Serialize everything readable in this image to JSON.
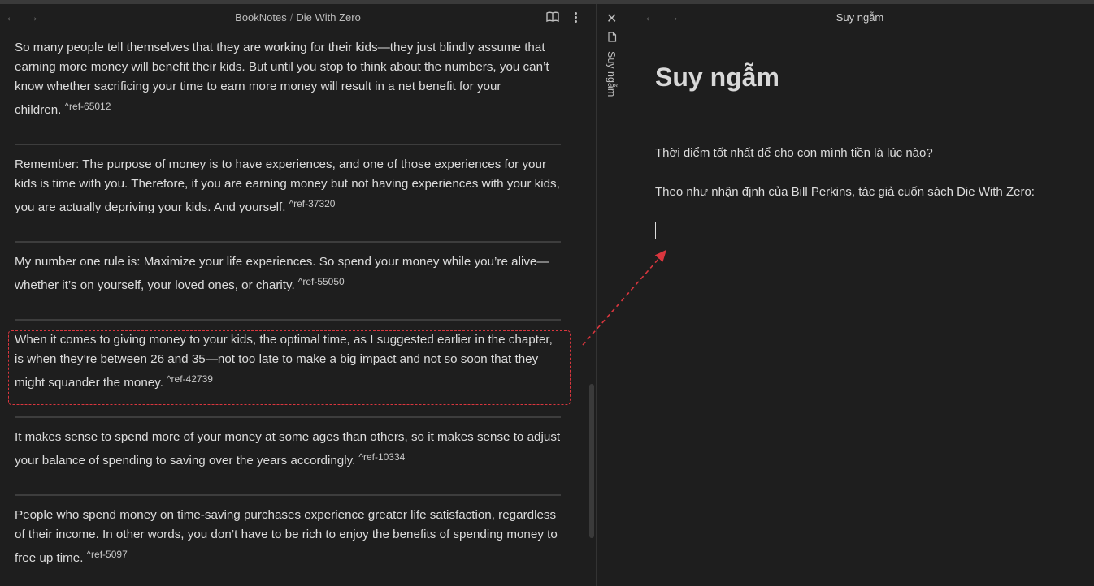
{
  "left_pane": {
    "breadcrumb": {
      "folder": "BookNotes",
      "separator": "/",
      "note": "Die With Zero"
    },
    "paragraphs": [
      {
        "text": "So many people tell themselves that they are working for their kids—they just blindly assume that earning more money will benefit their kids. But until you stop to think about the numbers, you can’t know whether sacrificing your time to earn more money will result in a net benefit for your children.",
        "ref": "^ref-65012"
      },
      {
        "text": "Remember: The purpose of money is to have experiences, and one of those experiences for your kids is time with you. Therefore, if you are earning money but not having experiences with your kids, you are actually depriving your kids. And yourself.",
        "ref": "^ref-37320"
      },
      {
        "text": "My number one rule is: Maximize your life experiences. So spend your money while you’re alive—whether it’s on yourself, your loved ones, or charity.",
        "ref": "^ref-55050"
      },
      {
        "text": "When it comes to giving money to your kids, the optimal time, as I suggested earlier in the chapter, is when they’re between 26 and 35—not too late to make a big impact and not so soon that they might squander the money.",
        "ref": "^ref-42739"
      },
      {
        "text": "It makes sense to spend more of your money at some ages than others, so it makes sense to adjust your balance of spending to saving over the years accordingly.",
        "ref": "^ref-10334"
      },
      {
        "text": "People who spend money on time-saving purchases experience greater life satisfaction, regardless of their income. In other words, you don’t have to be rich to enjoy the benefits of spending money to free up time.",
        "ref": "^ref-5097"
      }
    ]
  },
  "side_strip": {
    "vertical_title": "Suy ngẫm"
  },
  "right_pane": {
    "title": "Suy ngẫm",
    "heading": "Suy ngẫm",
    "lines": [
      "Thời điểm tốt nhất để cho con mình tiền là lúc nào?",
      "Theo như nhận định của Bill Perkins, tác giả cuốn sách Die With Zero:"
    ]
  },
  "icons": {
    "back": "←",
    "forward": "→",
    "close": "✕",
    "reading_mode": "book-open-icon",
    "more": "more-vertical-icon",
    "file": "file-icon"
  },
  "colors": {
    "background": "#1e1e1e",
    "annotation": "#d9363e",
    "text": "#dcdcdc"
  }
}
